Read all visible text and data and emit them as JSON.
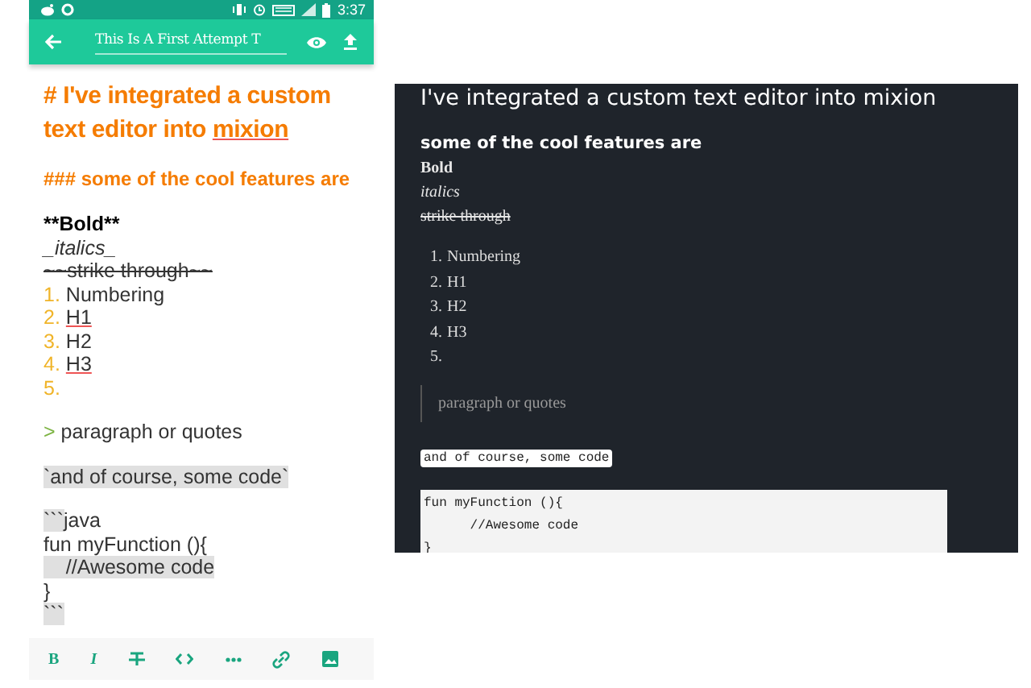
{
  "status_bar": {
    "time": "3:37"
  },
  "toolbar": {
    "title": "This Is A First Attempt T"
  },
  "editor": {
    "lines": [
      {
        "kind": "h1",
        "text": "# I've integrated a custom text editor into",
        "flagged": "mixion"
      },
      {
        "kind": "blank"
      },
      {
        "kind": "h3",
        "text": "### some of the cool features are"
      },
      {
        "kind": "blank"
      },
      {
        "kind": "bold",
        "text": "**Bold**"
      },
      {
        "kind": "italic",
        "text": "_italics_"
      },
      {
        "kind": "strike",
        "text": "~~strike through~~"
      },
      {
        "kind": "ol",
        "number": "1.",
        "text": "Numbering",
        "underlined": false
      },
      {
        "kind": "ol",
        "number": "2.",
        "text": "H1",
        "underlined": true
      },
      {
        "kind": "ol",
        "number": "3.",
        "text": "H2",
        "underlined": false
      },
      {
        "kind": "ol",
        "number": "4.",
        "text": "H3",
        "underlined": true
      },
      {
        "kind": "ol",
        "number": "5."
      },
      {
        "kind": "blank"
      },
      {
        "kind": "quote",
        "marker": ">",
        "text": "paragraph or quotes"
      },
      {
        "kind": "blank"
      },
      {
        "kind": "plain",
        "text": "`and of course, some code`",
        "highlighted": true
      },
      {
        "kind": "blank"
      },
      {
        "kind": "fence",
        "mark": "```",
        "text": "java"
      },
      {
        "kind": "plain",
        "text": "fun myFunction (){",
        "highlighted": false
      },
      {
        "kind": "plain",
        "text": "    //Awesome code",
        "highlighted": true
      },
      {
        "kind": "plain",
        "text": "}",
        "highlighted": false
      },
      {
        "kind": "fence",
        "mark": "```"
      }
    ]
  },
  "format_bar": [
    {
      "kind": "bold",
      "label": "B"
    },
    {
      "kind": "italic",
      "label": "I"
    },
    {
      "kind": "strike"
    },
    {
      "kind": "code"
    },
    {
      "kind": "more"
    },
    {
      "kind": "link"
    },
    {
      "kind": "image"
    }
  ],
  "preview": {
    "title": "I've integrated a custom text editor into mixion",
    "subtitle": "some of the cool features are",
    "bold": "Bold",
    "italic": "italics",
    "strike": "strike through",
    "list": [
      {
        "number": "1.",
        "text": "Numbering"
      },
      {
        "number": "2.",
        "text": "H1"
      },
      {
        "number": "3.",
        "text": "H2"
      },
      {
        "number": "4.",
        "text": "H3"
      },
      {
        "number": "5."
      }
    ],
    "quote": "paragraph or quotes",
    "inline_code": "and of course, some code",
    "code_lines": [
      "fun myFunction (){",
      "      //Awesome code",
      "}"
    ]
  }
}
